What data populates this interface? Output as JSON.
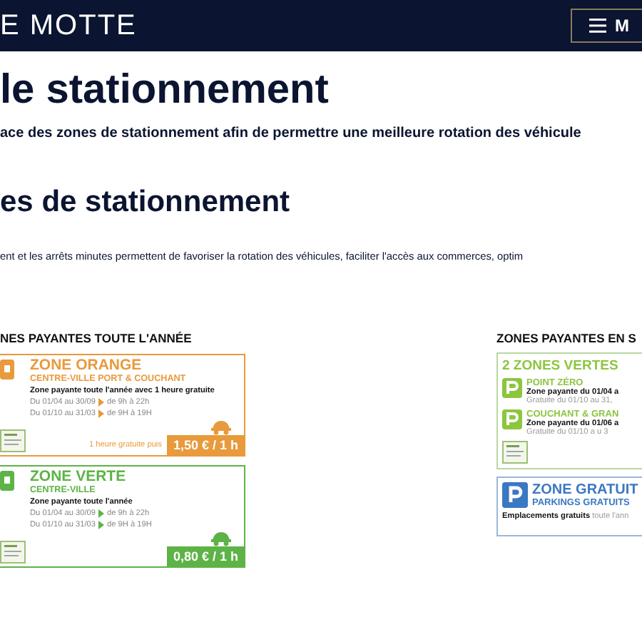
{
  "header": {
    "logo": "E MOTTE",
    "menu_button": "M"
  },
  "title": "le stationnement",
  "intro": "ace des zones de stationnement afin de permettre une meilleure rotation des véhicule",
  "section": {
    "title": "es de stationnement",
    "text": "ent et les arrêts minutes permettent de favoriser la rotation des véhicules, faciliter l'accès aux commerces, optim"
  },
  "left_panel": {
    "heading": "NES PAYANTES TOUTE L'ANNÉE",
    "zones": [
      {
        "name": "ZONE ORANGE",
        "subtitle": "CENTRE-VILLE PORT & COUCHANT",
        "description": "Zone payante toute l'année avec 1 heure gratuite",
        "color": "#e89a3c",
        "periods": [
          {
            "dates": "Du 01/04 au 30/09",
            "hours": "de 9h à 22h"
          },
          {
            "dates": "Du 01/10 au 31/03",
            "hours": "de 9H à 19H"
          }
        ],
        "note": "1 heure gratuite puis",
        "price": "1,50 € / 1 h"
      },
      {
        "name": "ZONE VERTE",
        "subtitle": "CENTRE-VILLE",
        "description": "Zone payante toute l'année",
        "color": "#5db346",
        "periods": [
          {
            "dates": "Du 01/04 au 30/09",
            "hours": "de 9h à 22h"
          },
          {
            "dates": "Du 01/10 au 31/03",
            "hours": "de 9H à 19H"
          }
        ],
        "price": "0,80 € / 1 h"
      }
    ]
  },
  "right_panel": {
    "heading": "ZONES PAYANTES EN S",
    "green_box": {
      "title": "2 ZONES VERTES",
      "items": [
        {
          "name": "POINT ZÉRO",
          "line_1": "Zone payante du 01/04 a",
          "line_2": "Gratuite du 01/10 au 31,"
        },
        {
          "name": "COUCHANT & GRAN",
          "line_1": "Zone payante du 01/06 a",
          "line_2": "Gratuite du  01/10 a u 3"
        }
      ]
    },
    "free_box": {
      "title": "ZONE GRATUIT",
      "subtitle": "PARKINGS GRATUITS",
      "text": "**Emplacements gratuits** toute l'ann"
    }
  }
}
